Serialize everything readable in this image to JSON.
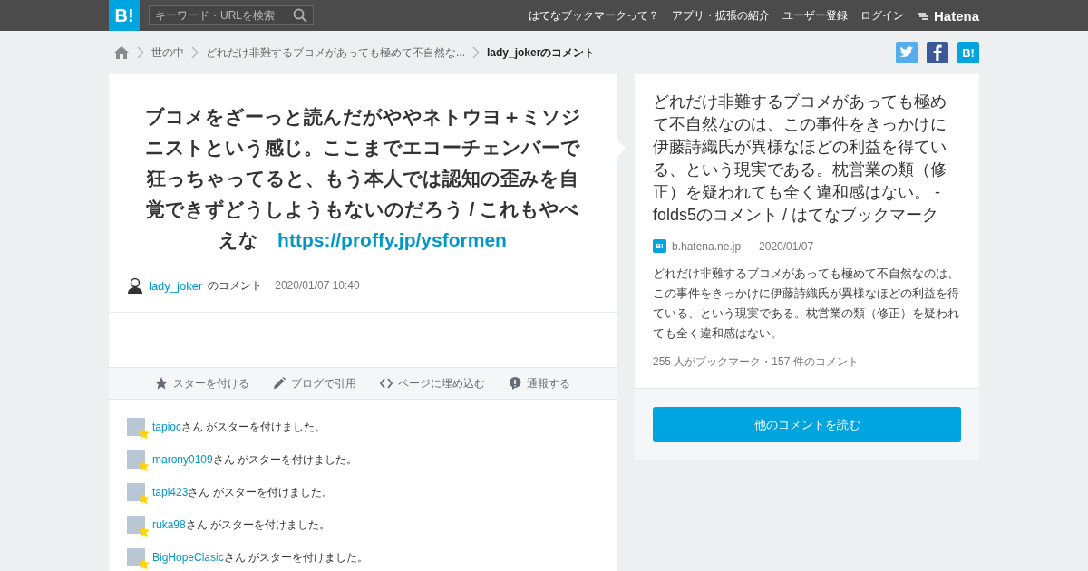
{
  "header": {
    "logo": "B!",
    "search": {
      "placeholder": "キーワード・URLを検索"
    },
    "nav": [
      "はてなブックマークって？",
      "アプリ・拡張の紹介",
      "ユーザー登録",
      "ログイン"
    ],
    "brand": "Hatena"
  },
  "breadcrumb": [
    "世の中",
    "どれだけ非難するブコメがあっても極めて不自然な...",
    "lady_jokerのコメント"
  ],
  "share": [
    {
      "kind": "twitter"
    },
    {
      "kind": "facebook"
    },
    {
      "kind": "hatena",
      "label": "B!"
    }
  ],
  "comment": {
    "text": "ブコメをざーっと読んだがややネトウヨ＋ミソジニストという感じ。ここまでエコーチェンバーで狂っちゃってると、もう本人では認知の歪みを自覚できずどうしようもないのだろう / これもやべえな　",
    "link": "https://proffy.jp/ysformen",
    "user": "lady_joker",
    "suffix": "のコメント",
    "date": "2020/01/07 10:40"
  },
  "actions": [
    {
      "kind": "star",
      "label": "スターを付ける"
    },
    {
      "kind": "pencil",
      "label": "ブログで引用"
    },
    {
      "kind": "code",
      "label": "ページに埋め込む"
    },
    {
      "kind": "alert",
      "label": "通報する"
    }
  ],
  "stars": [
    {
      "user": "tapioc",
      "text": "さん がスターを付けました。"
    },
    {
      "user": "marony0109",
      "text": "さん がスターを付けました。"
    },
    {
      "user": "tapi423",
      "text": "さん がスターを付けました。"
    },
    {
      "user": "ruka98",
      "text": "さん がスターを付けました。"
    },
    {
      "user": "BigHopeClasic",
      "text": "さん がスターを付けました。"
    }
  ],
  "entry": {
    "title": "どれだけ非難するブコメがあっても極めて不自然なのは、この事件をきっかけに伊藤詩織氏が異様なほどの利益を得ている、という現実である。枕営業の類（修正）を疑われても全く違和感はない。 - folds5のコメント / はてなブックマーク",
    "favicon": "B!",
    "domain": "b.hatena.ne.jp",
    "date": "2020/01/07",
    "description": "どれだけ非難するブコメがあっても極めて不自然なのは、この事件をきっかけに伊藤詩織氏が異様なほどの利益を得ている、という現実である。枕営業の類（修正）を疑われても全く違和感はない。",
    "counts": "255 人がブックマーク・157 件のコメント",
    "button": "他のコメントを読む"
  }
}
